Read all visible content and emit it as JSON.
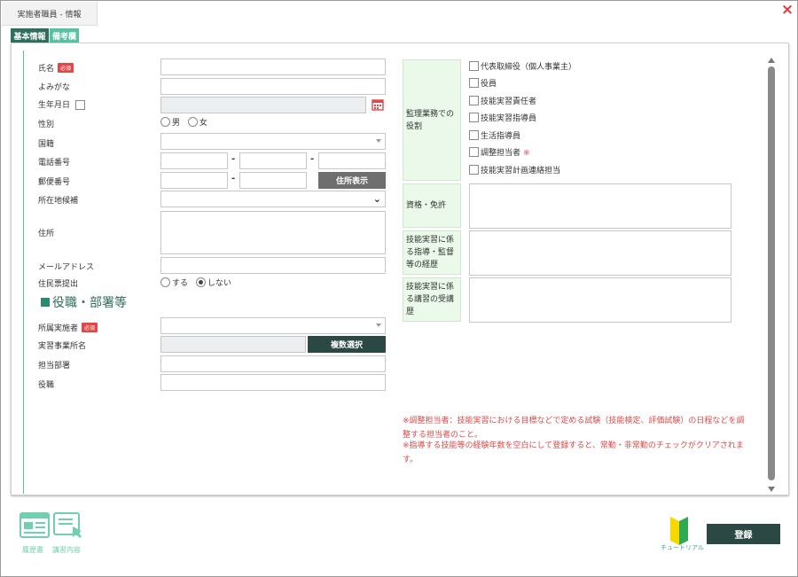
{
  "window": {
    "title": "実施者職員 - 情報",
    "close": "×"
  },
  "tabs": [
    {
      "label": "基本情報"
    },
    {
      "label": "備考欄"
    }
  ],
  "badges": {
    "required": "必須"
  },
  "form": {
    "name_label": "氏名",
    "kana_label": "よみがな",
    "birth_label": "生年月日",
    "gender_label": "性別",
    "gender_male": "男",
    "gender_female": "女",
    "nationality_label": "国籍",
    "phone_label": "電話番号",
    "phone_sep": "-",
    "postal_label": "郵便番号",
    "postal_sep": "-",
    "address_lookup_button": "住所表示",
    "location_label": "所在地候補",
    "address_label": "住所",
    "email_label": "メールアドレス",
    "resident_label": "住民票提出",
    "resident_yes": "する",
    "resident_no": "しない",
    "resident_selected": "しない"
  },
  "section2": {
    "title": "役職・部署等",
    "org_label": "所属実施者",
    "office_label": "実習事業所名",
    "multi_select_button": "複数選択",
    "dept_label": "担当部署",
    "position_label": "役職"
  },
  "roles": {
    "label": "監理業務での役割",
    "items": [
      {
        "label": "代表取締役（個人事業主）",
        "mark": ""
      },
      {
        "label": "役員",
        "mark": ""
      },
      {
        "label": "技能実習責任者",
        "mark": ""
      },
      {
        "label": "技能実習指導員",
        "mark": ""
      },
      {
        "label": "生活指導員",
        "mark": ""
      },
      {
        "label": "調整担当者",
        "mark": "※"
      },
      {
        "label": "技能実習計画連絡担当",
        "mark": ""
      }
    ]
  },
  "right_fields": {
    "qualification_label": "資格・免許",
    "guidance_label": "技能実習に係る指導・監督等の経歴",
    "training_label": "技能実習に係る講習の受講歴"
  },
  "notes": {
    "note1": "※調整担当者：技能実習における目標などで定める試験（技能検定、評価試験）の日程などを調整する担当者のこと。",
    "note2": "※指導する技能等の経験年数を空白にして登録すると、常勤・非常勤のチェックがクリアされます。"
  },
  "footer": {
    "icon1_label": "履歴書",
    "icon2_label": "講習内容",
    "tutorial_label": "チュートリアル",
    "register_button": "登録"
  },
  "colors": {
    "accent": "#2f6e5c",
    "light_accent": "#56c2a2",
    "required": "#e04848",
    "role_bg": "#eaf9ea"
  }
}
